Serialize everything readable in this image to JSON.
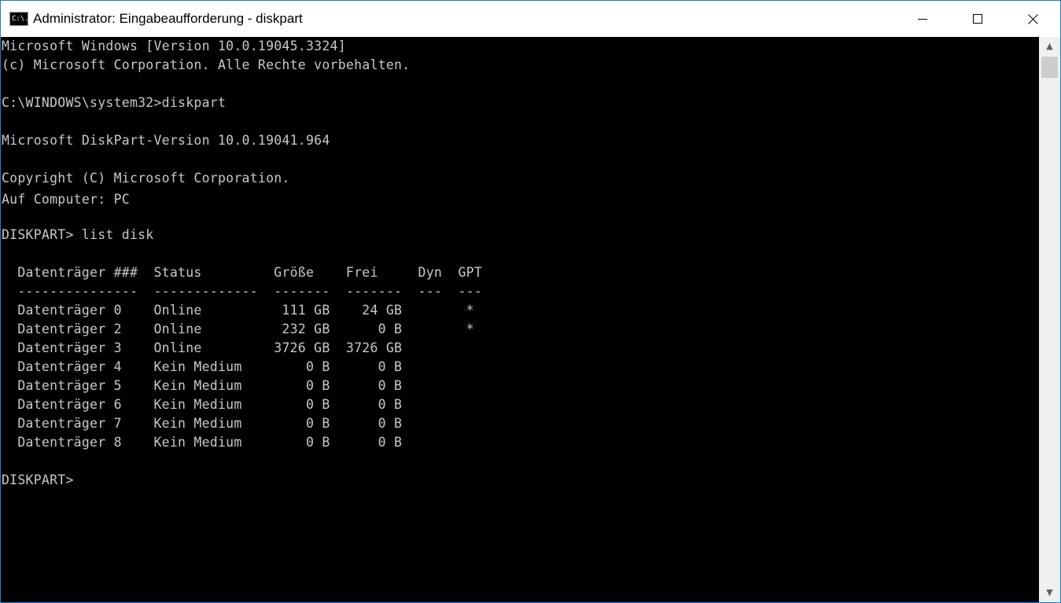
{
  "window": {
    "icon_text": "C:\\.",
    "title": "Administrator: Eingabeaufforderung - diskpart"
  },
  "console": {
    "lines": [
      "Microsoft Windows [Version 10.0.19045.3324]",
      "(c) Microsoft Corporation. Alle Rechte vorbehalten.",
      "C:\\WINDOWS\\system32>diskpart",
      "Microsoft DiskPart-Version 10.0.19041.964",
      "Copyright (C) Microsoft Corporation.",
      "Auf Computer: PC",
      "DISKPART> list disk",
      "  Datenträger ###  Status         Größe    Frei     Dyn  GPT",
      "  ---------------  -------------  -------  -------  ---  ---",
      "  Datenträger 0    Online          111 GB    24 GB        *",
      "  Datenträger 2    Online          232 GB      0 B        *",
      "  Datenträger 3    Online         3726 GB  3726 GB",
      "  Datenträger 4    Kein Medium        0 B      0 B",
      "  Datenträger 5    Kein Medium        0 B      0 B",
      "  Datenträger 6    Kein Medium        0 B      0 B",
      "  Datenträger 7    Kein Medium        0 B      0 B",
      "  Datenträger 8    Kein Medium        0 B      0 B",
      "DISKPART>"
    ]
  },
  "scrollbar": {
    "up_icon": "scroll-up-arrow",
    "down_icon": "scroll-down-arrow"
  }
}
